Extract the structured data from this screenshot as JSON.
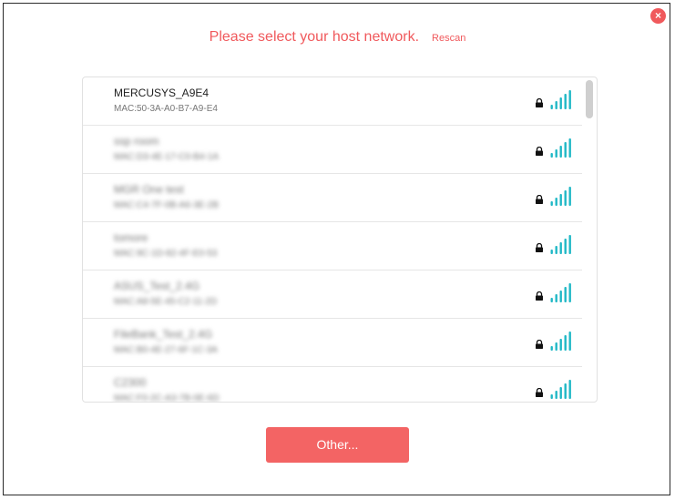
{
  "header": {
    "title": "Please select your host network.",
    "rescan_label": "Rescan",
    "close_glyph": "×"
  },
  "networks": [
    {
      "name": "MERCUSYS_A9E4",
      "mac": "MAC:50-3A-A0-B7-A9-E4",
      "locked": true,
      "signal": 4,
      "blurred": false
    },
    {
      "name": "ssp room",
      "mac": "MAC:D3-4E-17-C0-B4-1A",
      "locked": true,
      "signal": 4,
      "blurred": true
    },
    {
      "name": "MGR One test",
      "mac": "MAC:C4-7F-0B-A6-3E-2B",
      "locked": true,
      "signal": 4,
      "blurred": true
    },
    {
      "name": "tomore",
      "mac": "MAC:9C-1D-82-4F-E0-53",
      "locked": true,
      "signal": 4,
      "blurred": true
    },
    {
      "name": "ASUS_Test_2.4G",
      "mac": "MAC:A8-5E-45-C2-11-2D",
      "locked": true,
      "signal": 4,
      "blurred": true
    },
    {
      "name": "FileBank_Test_2.4G",
      "mac": "MAC:B0-4E-27-6F-1C-3A",
      "locked": true,
      "signal": 4,
      "blurred": true
    },
    {
      "name": "C2300",
      "mac": "MAC:F0-2C-A3-7B-0E-6D",
      "locked": true,
      "signal": 4,
      "blurred": true
    }
  ],
  "footer": {
    "other_label": "Other..."
  },
  "colors": {
    "accent": "#f0595c",
    "signal": "#20b8c6",
    "button": "#f36464"
  },
  "icons": {
    "close": "close-icon",
    "lock": "lock-icon",
    "signal": "wifi-signal-icon"
  }
}
